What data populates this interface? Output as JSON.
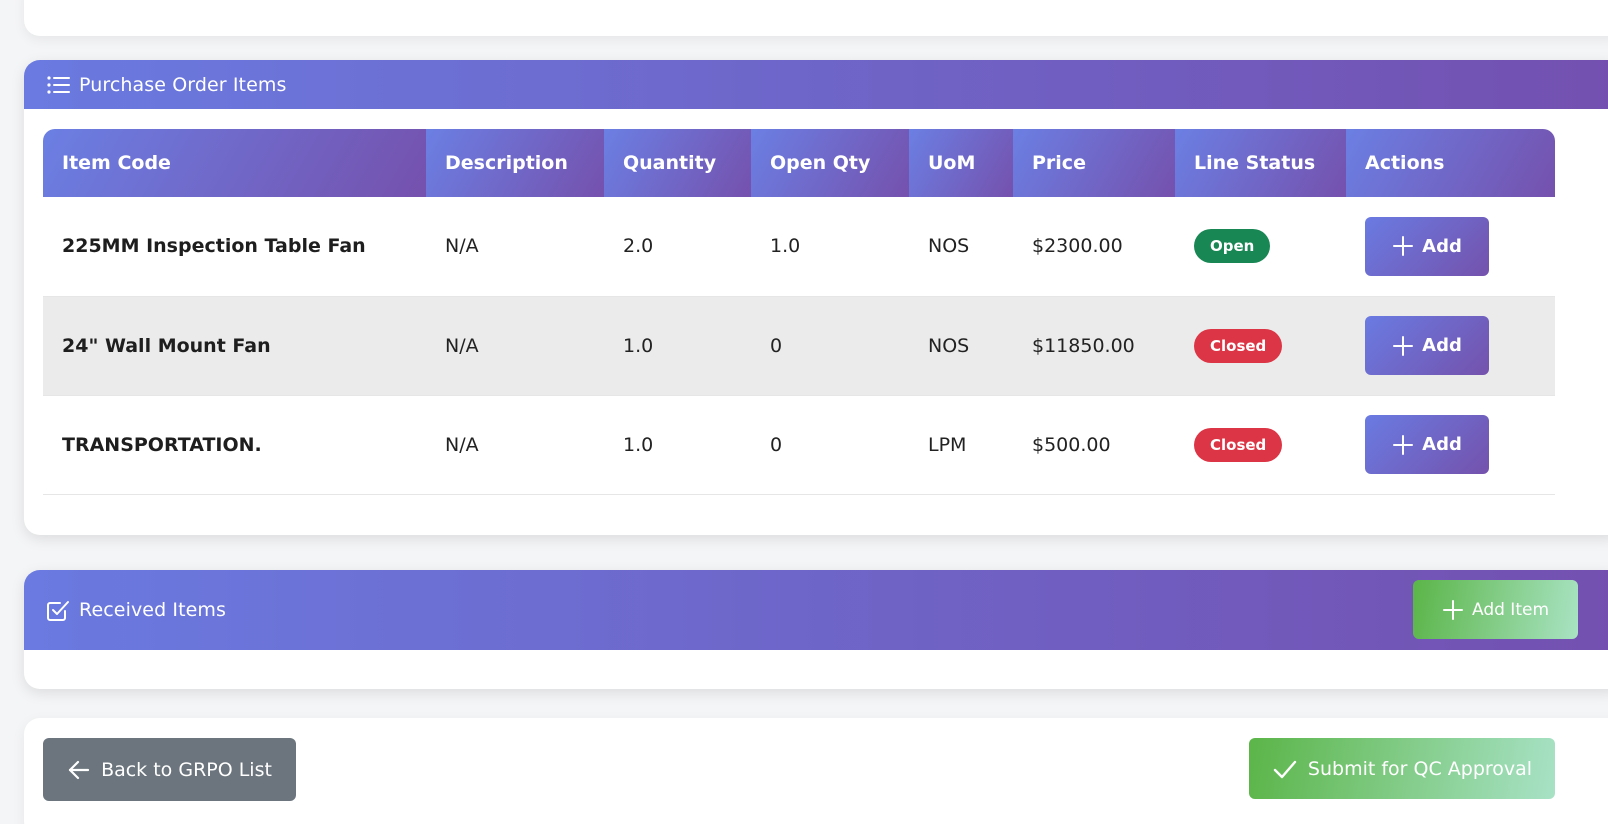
{
  "po_items": {
    "title": "Purchase Order Items",
    "columns": [
      "Item Code",
      "Description",
      "Quantity",
      "Open Qty",
      "UoM",
      "Price",
      "Line Status",
      "Actions"
    ],
    "rows": [
      {
        "item_code": "225MM Inspection Table Fan",
        "description": "N/A",
        "quantity": "2.0",
        "open_qty": "1.0",
        "uom": "NOS",
        "price": "$2300.00",
        "status": "Open",
        "status_color": "#198754",
        "action_label": "Add"
      },
      {
        "item_code": "24\" Wall Mount Fan",
        "description": "N/A",
        "quantity": "1.0",
        "open_qty": "0",
        "uom": "NOS",
        "price": "$11850.00",
        "status": "Closed",
        "status_color": "#dc3545",
        "action_label": "Add"
      },
      {
        "item_code": "TRANSPORTATION.",
        "description": "N/A",
        "quantity": "1.0",
        "open_qty": "0",
        "uom": "LPM",
        "price": "$500.00",
        "status": "Closed",
        "status_color": "#dc3545",
        "action_label": "Add"
      }
    ]
  },
  "received_items": {
    "title": "Received Items",
    "add_item_label": "Add Item"
  },
  "footer": {
    "back_label": "Back to GRPO List",
    "submit_label": "Submit for QC Approval"
  },
  "icons": {
    "po_header": "list-icon",
    "received_header": "checkbox-icon",
    "add": "plus-icon",
    "back": "arrow-left-icon",
    "submit": "check-icon"
  },
  "colors": {
    "header_gradient_start": "#6a7ae0",
    "header_gradient_end": "#7350b0",
    "open_badge": "#198754",
    "closed_badge": "#dc3545",
    "success_gradient_start": "#5bb548",
    "secondary_button": "#6c757d"
  }
}
